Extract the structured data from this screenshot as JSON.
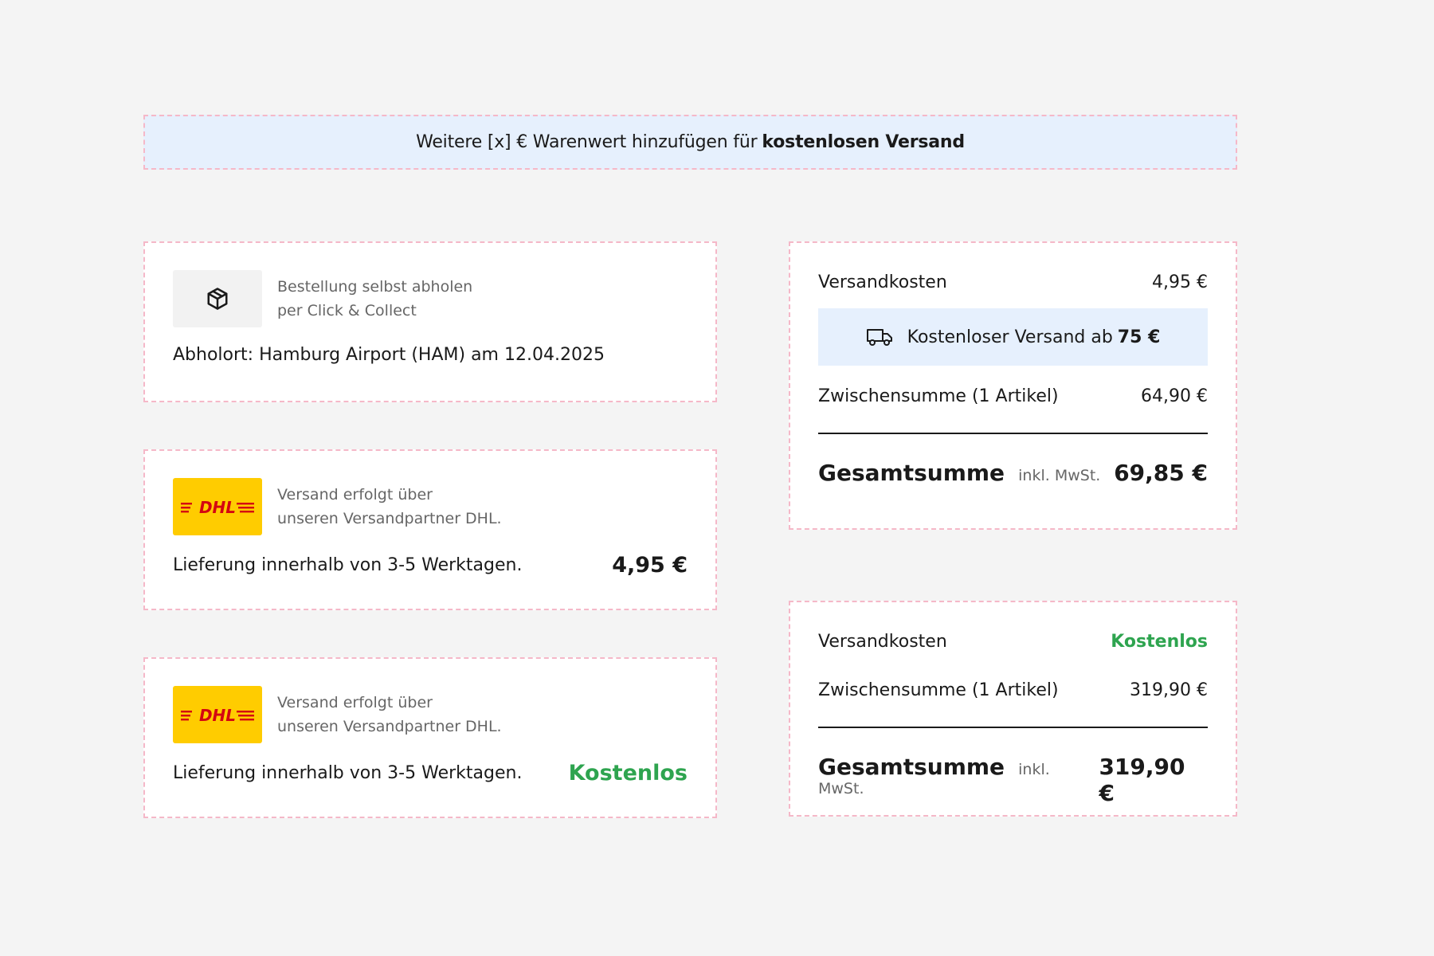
{
  "banner": {
    "prefix": "Weitere [x] € Warenwert hinzufügen für",
    "highlight": "kostenlosen Versand"
  },
  "pickup_card": {
    "icon": "package-icon",
    "desc_line1": "Bestellung selbst abholen",
    "desc_line2": "per Click & Collect",
    "location": "Abholort: Hamburg Airport (HAM) am 12.04.2025"
  },
  "dhl_card_paid": {
    "logo_text": "DHL",
    "desc_line1": "Versand erfolgt über",
    "desc_line2": "unseren Versandpartner DHL.",
    "delivery": "Lieferung innerhalb von 3-5 Werktagen.",
    "price": "4,95 €"
  },
  "dhl_card_free": {
    "logo_text": "DHL",
    "desc_line1": "Versand erfolgt über",
    "desc_line2": "unseren Versandpartner DHL.",
    "delivery": "Lieferung innerhalb von 3-5 Werktagen.",
    "price": "Kostenlos"
  },
  "summary_paid": {
    "shipping_label": "Versandkosten",
    "shipping_value": "4,95 €",
    "free_ship_text": "Kostenloser Versand ab",
    "free_ship_amount": "75 €",
    "free_ship_icon": "truck-icon",
    "subtotal_label": "Zwischensumme (1 Artikel)",
    "subtotal_value": "64,90 €",
    "total_label": "Gesamtsumme",
    "total_note": "inkl. MwSt.",
    "total_value": "69,85 €"
  },
  "summary_free": {
    "shipping_label": "Versandkosten",
    "shipping_value": "Kostenlos",
    "subtotal_label": "Zwischensumme (1 Artikel)",
    "subtotal_value": "319,90 €",
    "total_label": "Gesamtsumme",
    "total_note": "inkl. MwSt.",
    "total_value": "319,90 €"
  },
  "colors": {
    "accent_green": "#2ea44f",
    "info_blue": "#e6f0fd",
    "dhl_yellow": "#ffcc00",
    "dhl_red": "#d40511",
    "dashed_border": "#f5b8c8"
  }
}
